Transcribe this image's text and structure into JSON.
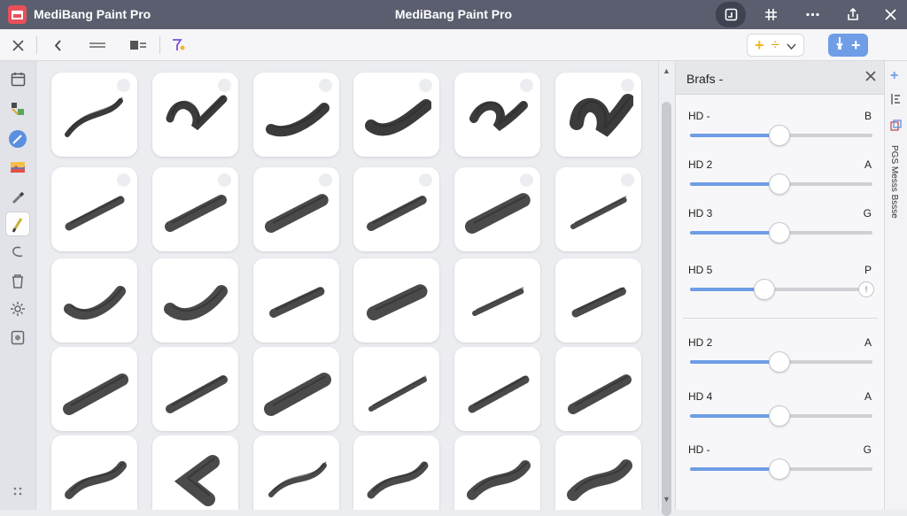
{
  "titlebar": {
    "app_name": "MediBang Paint Pro",
    "window_title": "MediBang Paint Pro",
    "buttons": [
      "layout-icon",
      "grid-icon",
      "more-icon",
      "share-icon",
      "close-icon"
    ]
  },
  "toolbar": {
    "close_icon": "✕",
    "back_icon": "‹",
    "tools": [
      "close-icon",
      "back-icon",
      "swap-icon",
      "layer-icon",
      "magic-icon",
      "add-icon",
      "divide-icon",
      "chevron-down-icon",
      "brush-down-icon",
      "plus-icon"
    ]
  },
  "sidebar": {
    "tools": [
      "calendar-icon",
      "selection-icon",
      "pen-icon",
      "image-icon",
      "eyedropper-icon",
      "brush-icon",
      "lasso-icon",
      "trash-icon",
      "settings-icon",
      "shield-icon"
    ],
    "selected_index": 5,
    "footer_icon": "dots-icon"
  },
  "brush_grid": {
    "rows": 5,
    "cols": 6,
    "stroke_color": "#2a2a2a"
  },
  "panel": {
    "title": "Brafs -",
    "rows": [
      {
        "label": "HD -",
        "key": "B",
        "value": 0.49
      },
      {
        "label": "HD 2",
        "key": "A",
        "value": 0.49
      },
      {
        "label": "HD 3",
        "key": "G",
        "value": 0.49
      },
      {
        "label": "HD 5",
        "key": "P",
        "value": 0.41
      },
      {
        "label": "HD 2",
        "key": "A",
        "value": 0.49
      },
      {
        "label": "HD 4",
        "key": "A",
        "value": 0.49
      },
      {
        "label": "HD -",
        "key": "G",
        "value": 0.49
      }
    ]
  },
  "right_strip": {
    "vertical_text": "PGS Messs Bssse"
  },
  "colors": {
    "accent": "#6f9de6",
    "titlebar": "#5a5e6e",
    "close_red": "#e8505b"
  }
}
